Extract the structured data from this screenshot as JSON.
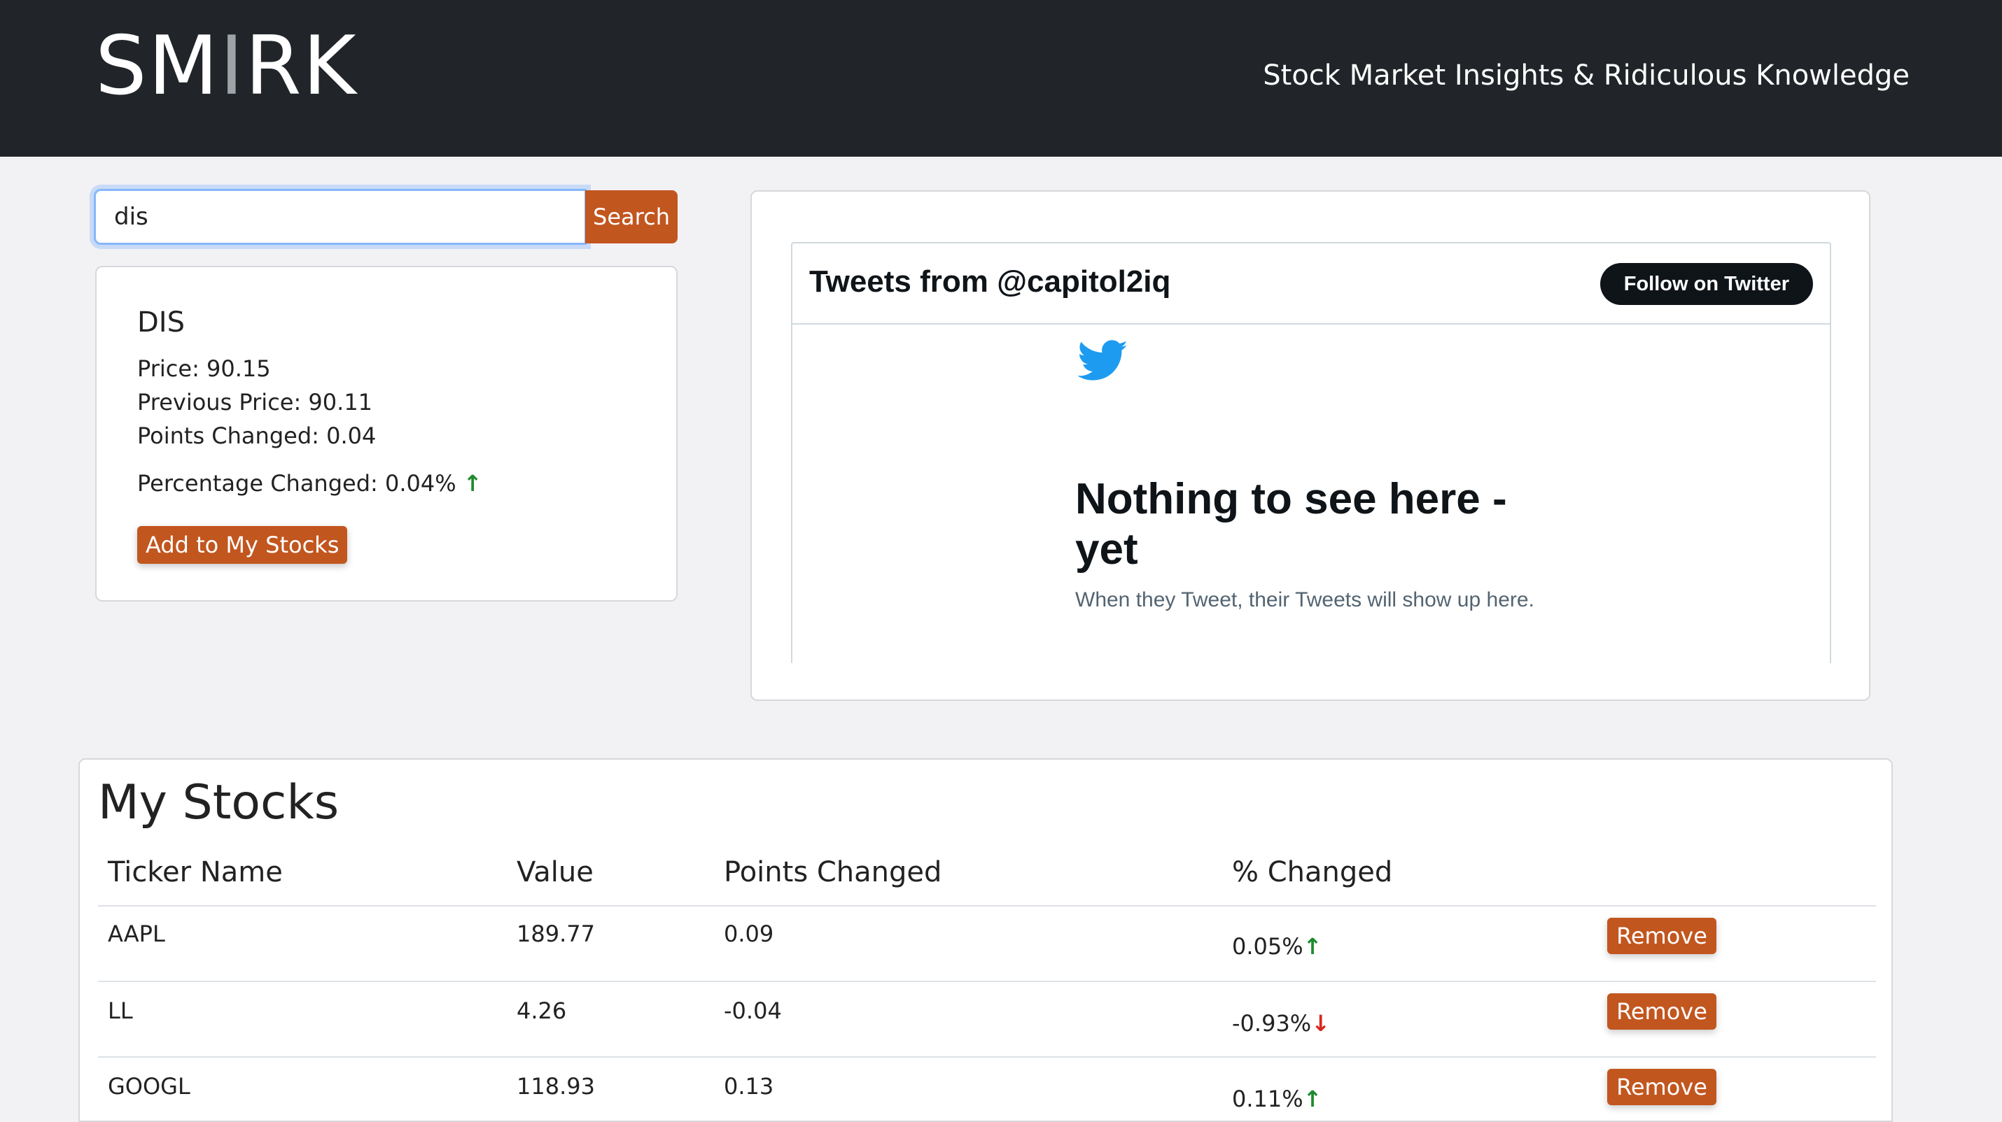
{
  "header": {
    "brand_main": "SM",
    "brand_dim": "I",
    "brand_end": "RK",
    "tagline": "Stock Market Insights & Ridiculous Knowledge"
  },
  "search": {
    "value": "dis",
    "button_label": "Search"
  },
  "result": {
    "ticker": "DIS",
    "price": "Price: 90.15",
    "previous_price": "Previous Price: 90.11",
    "points_changed": "Points Changed: 0.04",
    "percentage_changed": "Percentage Changed: 0.04%",
    "direction": "up",
    "add_label": "Add to My Stocks"
  },
  "twitter": {
    "title": "Tweets from @capitol2iq",
    "follow_label": "Follow on Twitter",
    "empty_title": "Nothing to see here - yet",
    "empty_subtitle": "When they Tweet, their Tweets will show up here."
  },
  "my_stocks": {
    "title": "My Stocks",
    "columns": [
      "Ticker Name",
      "Value",
      "Points Changed",
      "% Changed"
    ],
    "rows": [
      {
        "ticker": "AAPL",
        "value": "189.77",
        "points": "0.09",
        "percent": "0.05%",
        "direction": "up",
        "remove_label": "Remove"
      },
      {
        "ticker": "LL",
        "value": "4.26",
        "points": "-0.04",
        "percent": "-0.93%",
        "direction": "down",
        "remove_label": "Remove"
      },
      {
        "ticker": "GOOGL",
        "value": "118.93",
        "points": "0.13",
        "percent": "0.11%",
        "direction": "up",
        "remove_label": "Remove"
      }
    ]
  },
  "colors": {
    "navbar": "#212529",
    "accent": "#c2561f",
    "up": "#1e8a2e",
    "down": "#d8261d",
    "twitter_blue": "#1d9bf0"
  }
}
